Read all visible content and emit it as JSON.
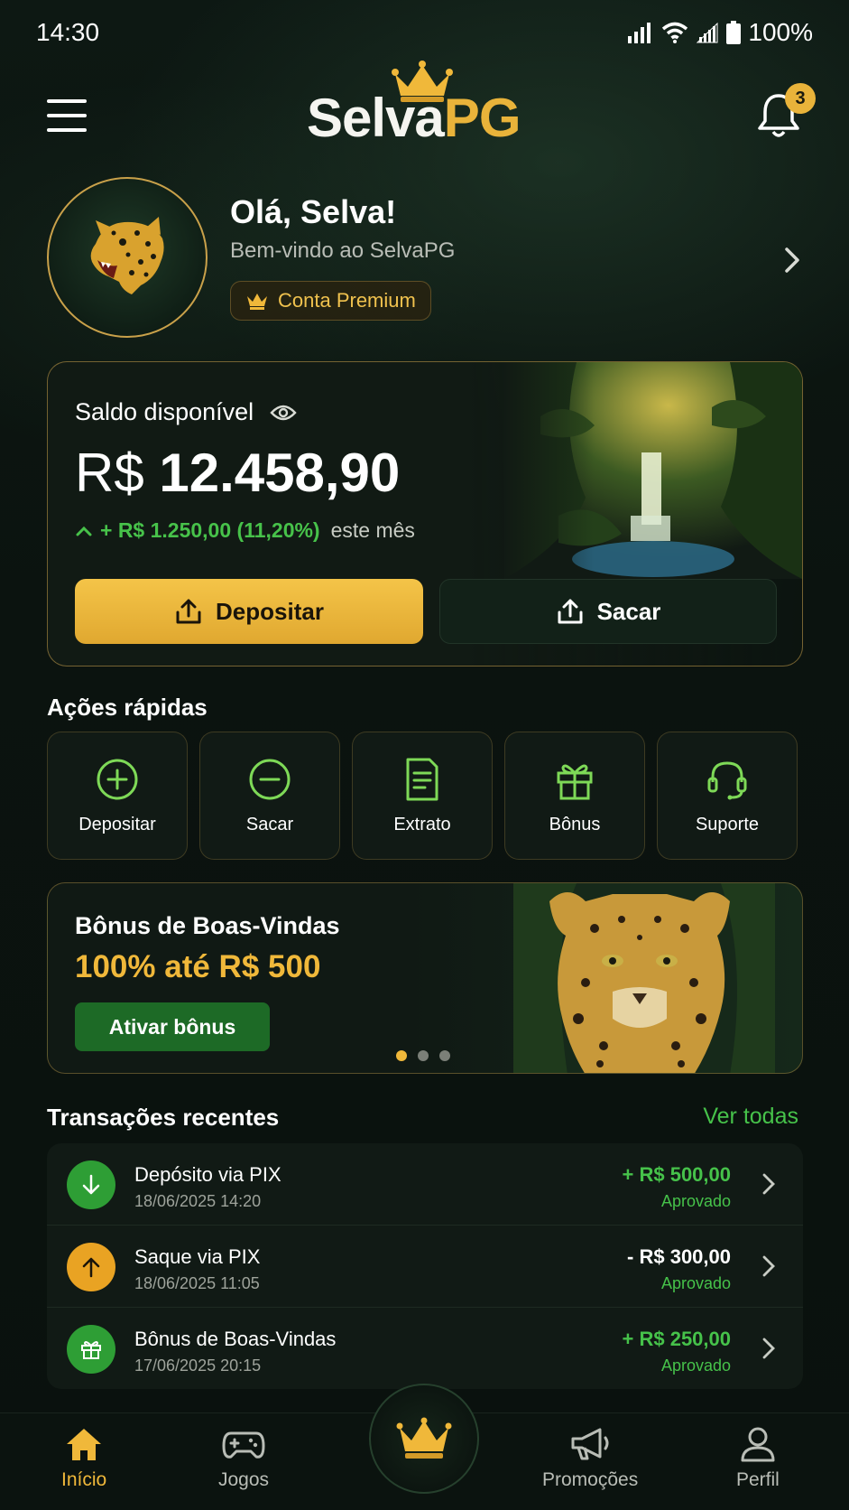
{
  "status_bar": {
    "time": "14:30",
    "battery": "100%"
  },
  "header": {
    "brand_part1": "Selva",
    "brand_part2": "PG",
    "notifications_count": "3"
  },
  "profile": {
    "greeting": "Olá, Selva!",
    "welcome": "Bem-vindo ao SelvaPG",
    "badge": "Conta Premium"
  },
  "balance": {
    "label": "Saldo disponível",
    "currency": "R$",
    "amount": "12.458,90",
    "change": "+ R$ 1.250,00 (11,20%)",
    "change_period": "este mês",
    "deposit_label": "Depositar",
    "withdraw_label": "Sacar"
  },
  "quick_actions": {
    "title": "Ações rápidas",
    "items": [
      {
        "label": "Depositar",
        "icon": "plus-circle-icon"
      },
      {
        "label": "Sacar",
        "icon": "minus-circle-icon"
      },
      {
        "label": "Extrato",
        "icon": "document-icon"
      },
      {
        "label": "Bônus",
        "icon": "gift-icon"
      },
      {
        "label": "Suporte",
        "icon": "headset-icon"
      }
    ]
  },
  "promo": {
    "title": "Bônus de Boas-Vindas",
    "subtitle": "100% até R$ 500",
    "button": "Ativar bônus",
    "active_slide": 1,
    "slide_count": 3
  },
  "transactions": {
    "title": "Transações recentes",
    "see_all": "Ver todas",
    "items": [
      {
        "name": "Depósito via PIX",
        "date": "18/06/2025 14:20",
        "amount": "+ R$ 500,00",
        "status": "Aprovado",
        "icon": "arrow-down-icon",
        "color": "#2e9e35"
      },
      {
        "name": "Saque via PIX",
        "date": "18/06/2025 11:05",
        "amount": "- R$ 300,00",
        "status": "Aprovado",
        "icon": "arrow-up-icon",
        "color": "#e9a323"
      },
      {
        "name": "Bônus de Boas-Vindas",
        "date": "17/06/2025 20:15",
        "amount": "+ R$ 250,00",
        "status": "Aprovado",
        "icon": "gift-icon",
        "color": "#2e9e35"
      }
    ]
  },
  "bottom_nav": {
    "items": [
      {
        "label": "Início",
        "icon": "home-icon",
        "active": true
      },
      {
        "label": "Jogos",
        "icon": "gamepad-icon",
        "active": false
      },
      {
        "label": "Promoções",
        "icon": "megaphone-icon",
        "active": false
      },
      {
        "label": "Perfil",
        "icon": "user-icon",
        "active": false
      }
    ],
    "center_icon": "crown-icon"
  },
  "colors": {
    "gold": "#f0b83a",
    "green": "#46c24a",
    "background": "#0b130f"
  }
}
